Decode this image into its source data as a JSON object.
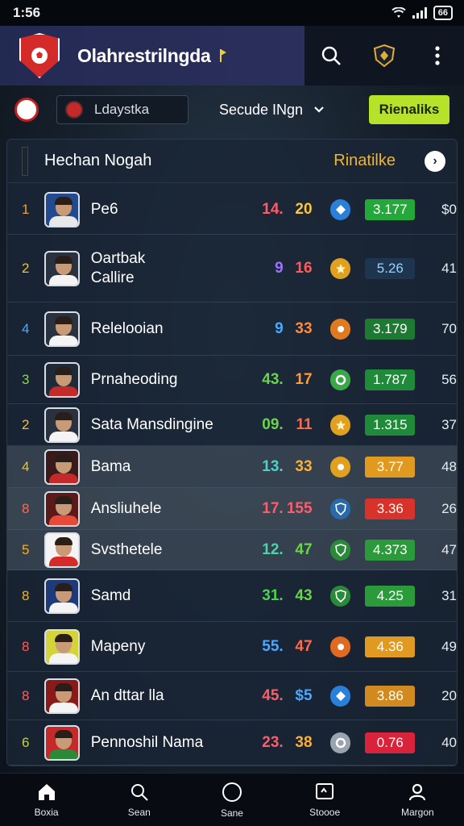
{
  "status": {
    "time": "1:56",
    "battery": "66"
  },
  "header": {
    "title": "Olahrestrilngda"
  },
  "filters": {
    "league": "Ldaystka",
    "season": "Secude INgn",
    "cta_label": "Rienaliks"
  },
  "panel": {
    "title": "Hechan Nogah",
    "sort_label": "Rinatilke"
  },
  "colors": {
    "brand": "#2b2f5c",
    "accent_green": "#b6e32a",
    "sort_orange": "#f0b532"
  },
  "rows": [
    {
      "rank": "1",
      "name": "Pe6",
      "s1": "14.",
      "s2": "20",
      "rating": "3.177",
      "pts": "$0",
      "rank_color": "#f0a030",
      "s1_color": "#ff5c6a",
      "s2_color": "#ffc43a",
      "rating_color": "#25a83a",
      "role_color": "#2a7fd8",
      "role_icon": "diamond-icon",
      "shirt": "#e8e8e8",
      "avatar_bg": "#234a8e"
    },
    {
      "rank": "2",
      "name": "Oartbak\nCallire",
      "s1": "9",
      "s2": "16",
      "rating": "5.26",
      "pts": "41",
      "rank_color": "#f0c030",
      "s1_color": "#a070ff",
      "s2_color": "#ff5a5a",
      "rating_color": "#1e3550",
      "role_color": "#e0a020",
      "role_icon": "star-icon",
      "shirt": "#f4f4f4",
      "avatar_bg": "#2a3240",
      "rating_text": "#8fd4ff"
    },
    {
      "rank": "4",
      "name": "Relelooian",
      "s1": "9",
      "s2": "33",
      "rating": "3.179",
      "pts": "70",
      "rank_color": "#4aa8ff",
      "s1_color": "#4aa8ff",
      "s2_color": "#ff8a3a",
      "rating_color": "#1e7a32",
      "role_color": "#e07a20",
      "role_icon": "circle-icon",
      "shirt": "#f4f4f4",
      "avatar_bg": "#2a3240"
    },
    {
      "rank": "3",
      "name": "Prnaheoding",
      "s1": "43.",
      "s2": "17",
      "rating": "1.787",
      "pts": "56",
      "rank_color": "#8ad44a",
      "s1_color": "#6ad44a",
      "s2_color": "#ff9a3a",
      "rating_color": "#1e8a3a",
      "role_color": "#3aa848",
      "role_icon": "ring-icon",
      "shirt": "#c42a2a",
      "avatar_bg": "#1e2a38"
    },
    {
      "rank": "2",
      "name": "Sata Mansdingine",
      "s1": "09.",
      "s2": "11",
      "rating": "1.315",
      "pts": "37",
      "rank_color": "#f0c030",
      "s1_color": "#6ad44a",
      "s2_color": "#ff6a4a",
      "rating_color": "#1e8a3a",
      "role_color": "#e0a020",
      "role_icon": "star-icon",
      "shirt": "#f4f4f4",
      "avatar_bg": "#2a3240"
    },
    {
      "rank": "4",
      "name": "Bama",
      "s1": "13.",
      "s2": "33",
      "rating": "3.77",
      "pts": "48",
      "rank_color": "#f0c030",
      "s1_color": "#4ad4c8",
      "s2_color": "#ffb030",
      "rating_color": "#e09a20",
      "role_color": "#e0a020",
      "role_icon": "circle-icon",
      "shirt": "#c42a2a",
      "avatar_bg": "#3a1a1a",
      "hl": "hl"
    },
    {
      "rank": "8",
      "name": "Ansliuhele",
      "s1": "17.",
      "s2": "155",
      "rating": "3.36",
      "pts": "26",
      "rank_color": "#ff6a4a",
      "s1_color": "#ff5c6a",
      "s2_color": "#ff5c6a",
      "rating_color": "#d8332a",
      "role_color": "#2a6aaa",
      "role_icon": "shield-icon",
      "shirt": "#e84a3a",
      "avatar_bg": "#5a1a1a",
      "hl": "hl2"
    },
    {
      "rank": "5",
      "name": "Svsthetele",
      "s1": "12.",
      "s2": "47",
      "rating": "4.373",
      "pts": "47",
      "rank_color": "#f0b030",
      "s1_color": "#4ad4a8",
      "s2_color": "#6ad44a",
      "rating_color": "#2a9a3a",
      "role_color": "#2a8a3a",
      "role_icon": "shield-icon",
      "shirt": "#d42a2a",
      "avatar_bg": "#f4f4f4",
      "hl": "hl"
    },
    {
      "rank": "8",
      "name": "Samd",
      "s1": "31.",
      "s2": "43",
      "rating": "4.25",
      "pts": "31",
      "rank_color": "#f0b030",
      "s1_color": "#4ad44a",
      "s2_color": "#6ad44a",
      "rating_color": "#2a9a3a",
      "role_color": "#2a8a3a",
      "role_icon": "shield-icon",
      "shirt": "#f4f4f4",
      "avatar_bg": "#1e3a7a"
    },
    {
      "rank": "8",
      "name": "Mapeny",
      "s1": "55.",
      "s2": "47",
      "rating": "4.36",
      "pts": "49",
      "rank_color": "#ff5a5a",
      "s1_color": "#4aa8ff",
      "s2_color": "#ff6a4a",
      "rating_color": "#e09a20",
      "role_color": "#e06a20",
      "role_icon": "circle-icon",
      "shirt": "#f4f4f4",
      "avatar_bg": "#d4d43a"
    },
    {
      "rank": "8",
      "name": "An dttar lla",
      "s1": "45.",
      "s2": "$5",
      "rating": "3.86",
      "pts": "20",
      "rank_color": "#ff5a5a",
      "s1_color": "#ff5c6a",
      "s2_color": "#4aa8ff",
      "rating_color": "#d08a20",
      "role_color": "#2a7fd8",
      "role_icon": "diamond-icon",
      "shirt": "#f4f4f4",
      "avatar_bg": "#8a1a1a"
    },
    {
      "rank": "6",
      "name": "Pennoshil Nama",
      "s1": "23.",
      "s2": "38",
      "rating": "0.76",
      "pts": "40",
      "rank_color": "#c8d43a",
      "s1_color": "#ff5c6a",
      "s2_color": "#ffb030",
      "rating_color": "#d8233a",
      "role_color": "#9aa4b0",
      "role_icon": "ring-icon",
      "shirt": "#2a8a3a",
      "avatar_bg": "#c42a2a"
    }
  ],
  "nav": [
    {
      "label": "Boxia",
      "icon": "home-icon"
    },
    {
      "label": "Sean",
      "icon": "search-icon"
    },
    {
      "label": "Sane",
      "icon": "circle-icon"
    },
    {
      "label": "Stoooe",
      "icon": "chart-box-icon"
    },
    {
      "label": "Margon",
      "icon": "profile-icon"
    }
  ]
}
